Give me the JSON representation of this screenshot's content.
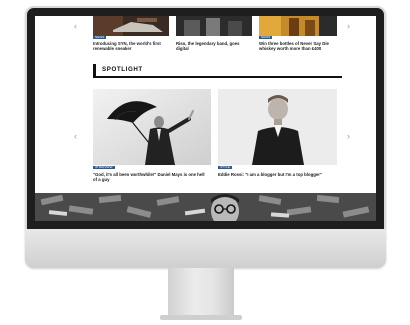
{
  "site": {
    "top_row": [
      {
        "caption": "Introducing SYN, the world's first renewable sneaker",
        "tag": "NEWS"
      },
      {
        "caption": "Riso, the legendary band, goes digital",
        "tag": ""
      },
      {
        "caption": "Win three bottles of Never Say Die whiskey worth more than £400",
        "tag": "NEWS"
      }
    ],
    "section_title": "SPOTLIGHT",
    "features": [
      {
        "tag": "INTERVIEW",
        "caption": "\"God, it's all been worthwhile!\" Daniel Mays is one hell of a guy"
      },
      {
        "tag": "STYLE",
        "caption": "Eddie Rossi: \"I am a blogger but I'm a top blogger\""
      }
    ],
    "nav": {
      "prev": "‹",
      "next": "›"
    }
  },
  "icons": {
    "prev": "chevron-left-icon",
    "next": "chevron-right-icon"
  }
}
